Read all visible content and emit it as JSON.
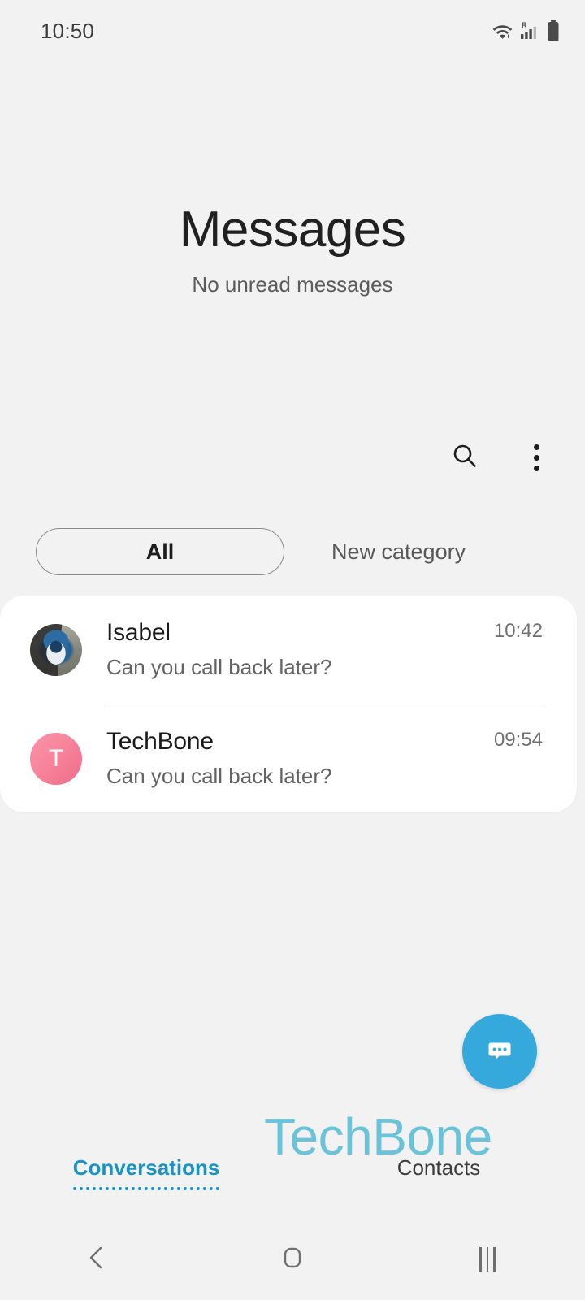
{
  "status_bar": {
    "time": "10:50",
    "icons": [
      "wifi-icon",
      "signal-roaming-icon",
      "battery-icon"
    ],
    "roaming_label": "R"
  },
  "header": {
    "title": "Messages",
    "subtitle": "No unread messages"
  },
  "actions": [
    {
      "name": "search-icon",
      "label": "Search"
    },
    {
      "name": "more-options-icon",
      "label": "More options"
    }
  ],
  "chips": [
    {
      "label": "All",
      "selected": true
    },
    {
      "label": "New category",
      "selected": false
    }
  ],
  "conversations": [
    {
      "name": "Isabel",
      "preview": "Can you call back later?",
      "time": "10:42",
      "avatar_type": "photo"
    },
    {
      "name": "TechBone",
      "preview": "Can you call back later?",
      "time": "09:54",
      "avatar_type": "letter",
      "avatar_letter": "T",
      "avatar_color": "#f7859c"
    }
  ],
  "fab": {
    "name": "new-conversation-icon",
    "color": "#35a8dc"
  },
  "watermark": {
    "text": "TechBone",
    "color": "#6bc3da"
  },
  "tabs": [
    {
      "label": "Conversations",
      "active": true
    },
    {
      "label": "Contacts",
      "active": false
    }
  ],
  "nav_bar": {
    "back": "back-icon",
    "home": "home-icon",
    "recents": "recents-icon"
  },
  "colors": {
    "background": "#f2f2f2",
    "card": "#ffffff",
    "accent": "#1a93c4",
    "fab": "#35a8dc",
    "avatar_pink": "#f7859c"
  }
}
